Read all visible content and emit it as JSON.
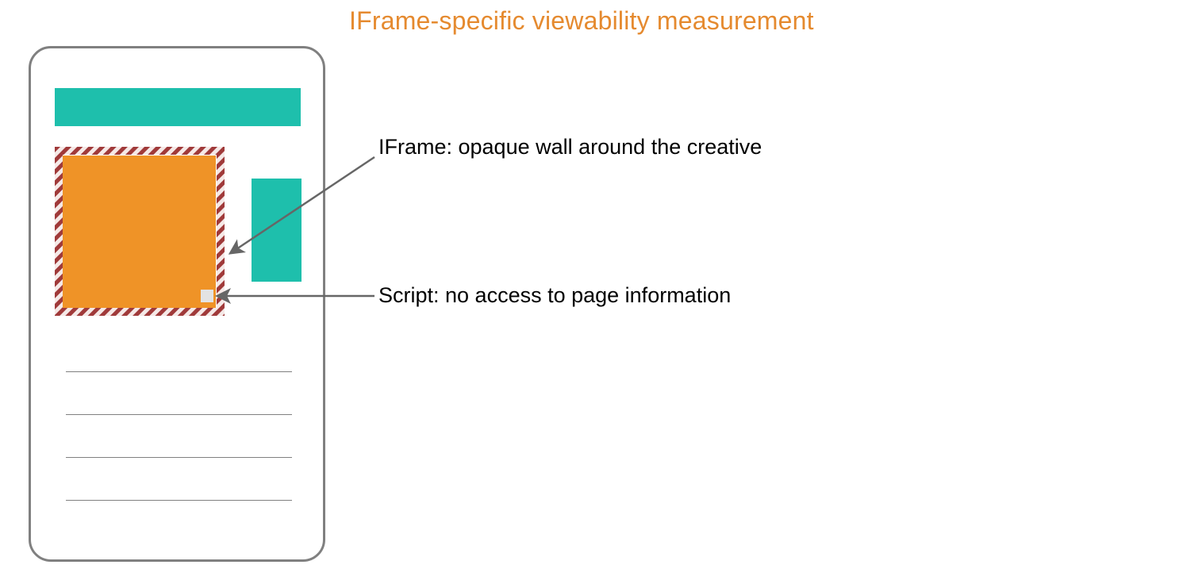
{
  "title": "IFrame-specific viewability measurement",
  "annotations": {
    "iframe": "IFrame: opaque wall around the creative",
    "script": "Script: no access to page information"
  },
  "colors": {
    "accent_orange_text": "#e58a2f",
    "creative_orange": "#ef9327",
    "teal": "#1ebfac",
    "stripe_maroon": "#a03a3a",
    "stripe_light": "#f5e9e7",
    "phone_gray": "#808080",
    "script_gray": "#e3e3e3"
  }
}
